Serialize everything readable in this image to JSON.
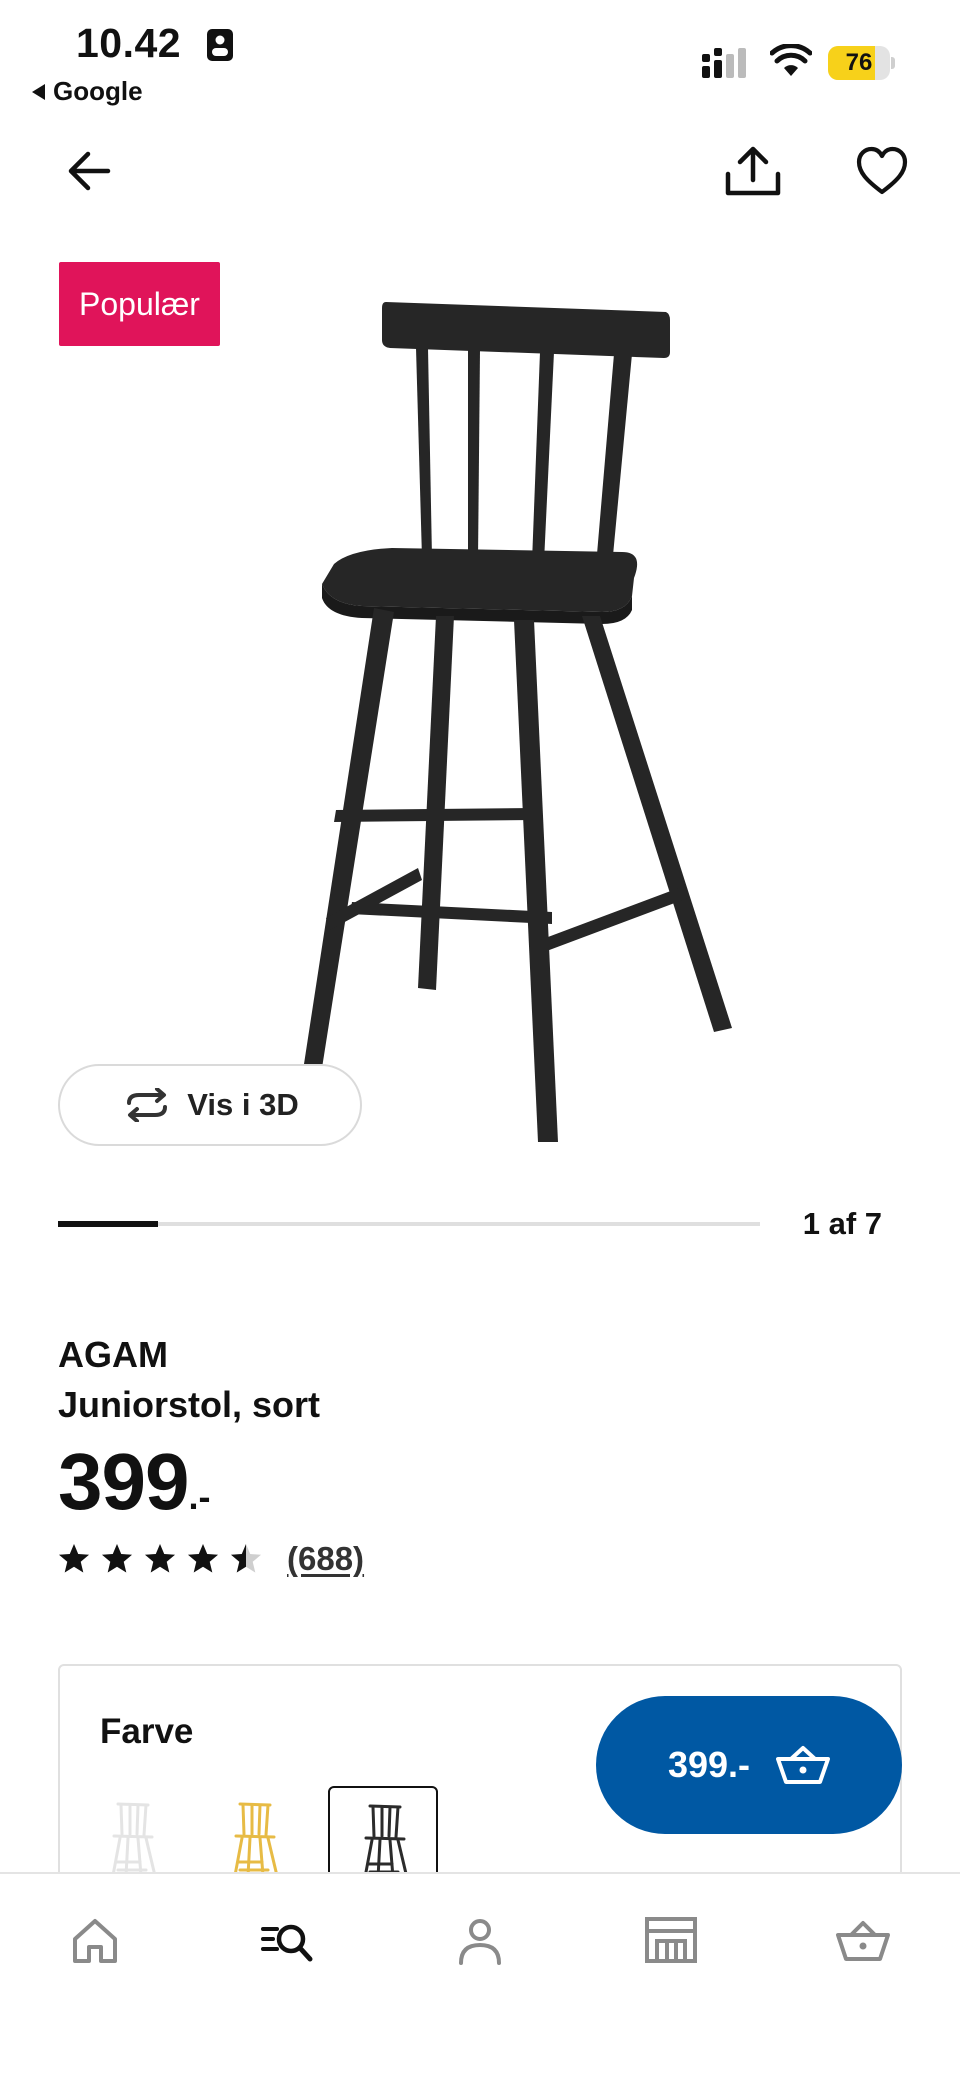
{
  "status_bar": {
    "time": "10.42",
    "back_app": "Google",
    "battery_level": "76",
    "battery_fraction": 0.76,
    "battery_color": "#f7d11a"
  },
  "nav": {
    "back_icon": "arrow-left-icon",
    "share_icon": "share-icon",
    "favorite_icon": "heart-icon"
  },
  "hero": {
    "badge": "Populær",
    "badge_color": "#e0145a",
    "view_3d_label": "Vis i 3D",
    "carousel": {
      "current": 1,
      "total": 7,
      "label": "1 af 7"
    }
  },
  "product": {
    "name": "AGAM",
    "description": "Juniorstol, sort",
    "price_main": "399",
    "price_suffix": ".-",
    "rating_value": 4.5,
    "rating_max": 5,
    "review_count": "(688)"
  },
  "color_selector": {
    "title": "Farve",
    "options": [
      {
        "name": "white",
        "color": "#e4e4e4",
        "selected": false
      },
      {
        "name": "yellow",
        "color": "#e7bb45",
        "selected": false
      },
      {
        "name": "black",
        "color": "#2b2b2b",
        "selected": true
      }
    ]
  },
  "add_to_cart": {
    "label": "399.-",
    "icon": "basket-icon",
    "color": "#0058a3"
  },
  "tabbar": {
    "items": [
      {
        "name": "home",
        "icon": "home-icon",
        "active": false
      },
      {
        "name": "search",
        "icon": "search-icon",
        "active": true
      },
      {
        "name": "profile",
        "icon": "profile-icon",
        "active": false
      },
      {
        "name": "store",
        "icon": "store-icon",
        "active": false
      },
      {
        "name": "cart",
        "icon": "basket-icon",
        "active": false
      }
    ]
  }
}
